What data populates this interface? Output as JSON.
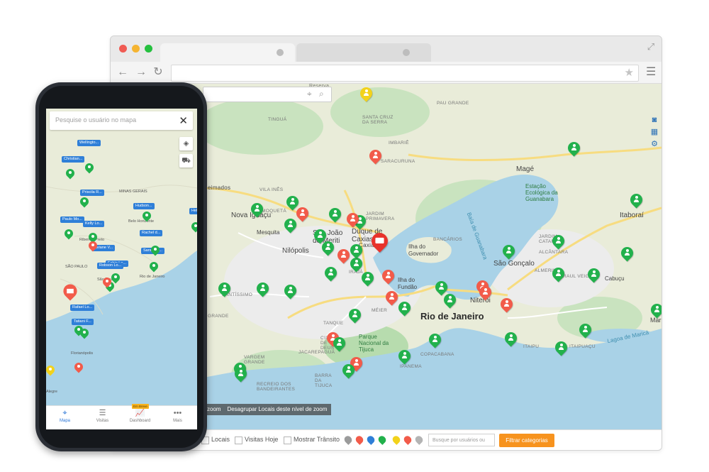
{
  "browser": {
    "window_dots": [
      "#f05b53",
      "#f5b431",
      "#25c03f"
    ],
    "expand_icon": "expand-icon",
    "nav": {
      "back_icon": "arrow-left-icon",
      "forward_icon": "arrow-right-icon",
      "reload_icon": "reload-icon"
    },
    "url": "",
    "bookmark_icon": "star-icon",
    "menu_icon": "hamburger-icon"
  },
  "map": {
    "search": {
      "placeholder": "",
      "location_icon": "map-pin-icon",
      "search_icon": "search-icon"
    },
    "side_tools": [
      "camera-icon",
      "calendar-icon",
      "gear-icon"
    ],
    "labels": {
      "rio": "Rio de Janeiro",
      "mage": "Magé",
      "niteroi": "Niterói",
      "sao_goncalo": "São Gonçalo",
      "itaborai": "Itaboraí",
      "nova_iguacu": "Nova Iguaçu",
      "sao_joao": "São João de Meriti",
      "duque": "Duque de Caxias",
      "nilopolis": "Nilópolis",
      "mesquita": "Mesquita",
      "ilha_gov": "Ilha do Governador",
      "ilha_fundao": "Ilha do Fundão",
      "parque": "Parque Nacional da Tijuca",
      "estacao": "Estação Ecológica da Guanabara",
      "baia": "Baía de Guanabara",
      "lagoa": "Lagoa de Maricá",
      "tingua": "TINGUÁ",
      "pau_grande": "PAU GRANDE",
      "santa_cruz": "SANTA CRUZ DA SERRA",
      "saracuruna": "SARACURUNA",
      "jardim": "JARDIM PRIMAVERA",
      "moquetá": "MOQUETÁ",
      "santissimo": "SANTÍSSIMO",
      "grande": "GRANDE",
      "meier": "MÉIER",
      "tanque": "TANQUE",
      "cidade_deus": "CIDADE DE DEUS",
      "jacarepagua": "JACAREPAGUÁ",
      "copacabana": "COPACABANA",
      "ipanema": "IPANEMA",
      "barra": "BARRA DA TIJUCA",
      "recreio": "RECREIO DOS BANDEIRANTES",
      "vargem": "VARGEM GRANDE",
      "itaipu": "ITAIPU",
      "itaipuacu": "ITAIPUAÇU",
      "alcantara": "ALCÂNTARA",
      "almerinda": "ALMERINDA",
      "raul_veiga": "RAUL VEIGA",
      "cabucu": "Cabuçu",
      "jardim_catarina": "JARDIM CATARINA",
      "reserva": "Reserva",
      "bancarios": "BANCÁRIOS",
      "caxias": "Caxias",
      "irajá": "IRAJÁ",
      "imbariê": "IMBARIÊ",
      "queimados": "eimados",
      "marica": "Mari",
      "vila_ines": "VILA INÊS"
    },
    "zoom_hint": "Desagrupar Locais deste nível de zoom",
    "zoom_partial": "zoom",
    "colors": {
      "water": "#a9d2e7",
      "green": "#22b14c",
      "red": "#f25b4a",
      "yellow": "#f2d21b",
      "park": "#b7dcae",
      "road": "#f7dc80"
    }
  },
  "filterbar": {
    "locals": "Locais",
    "visitas_hoje": "Visitas Hoje",
    "mostrar_transito": "Mostrar Trânsito",
    "search_placeholder": "Busque por usuários ou lote",
    "filter_button": "Filtrar categorias",
    "legend_icons": [
      "pin-gray-icon",
      "lock-red-icon",
      "car-blue-icon",
      "person-green-icon",
      "person-yellow-icon",
      "person-red-icon",
      "person-gray-icon"
    ]
  },
  "phone": {
    "search_placeholder": "Pesquise o usuário no mapa",
    "close_icon": "close-icon",
    "layer_icon": "layers-icon",
    "car_icon": "car-icon",
    "tags": [
      "Wellingto...",
      "Christian...",
      "Priscila R...",
      "Hudson...",
      "Paulo Mo...",
      "Kelly Lo...",
      "Rachel d...",
      "Viviane V...",
      "Fabio Lo...",
      "Sandro L...",
      "Robson Lo...",
      "Rafael Lo...",
      "Tatiani F...",
      "Helon G..."
    ],
    "places": [
      "MINAS GERAIS",
      "Belo Horizonte",
      "Ribeirão Preto",
      "SÃO PAULO",
      "São Paulo",
      "Rio de Janeiro",
      "Florianópolis",
      "Alegre"
    ],
    "tabs": [
      {
        "label": "Mapa",
        "icon": "map-pin-icon"
      },
      {
        "label": "Visitas",
        "icon": "list-icon"
      },
      {
        "label": "Dashboard",
        "icon": "chart-icon",
        "badge": "Em Breve"
      },
      {
        "label": "Mais",
        "icon": "more-icon"
      }
    ]
  }
}
